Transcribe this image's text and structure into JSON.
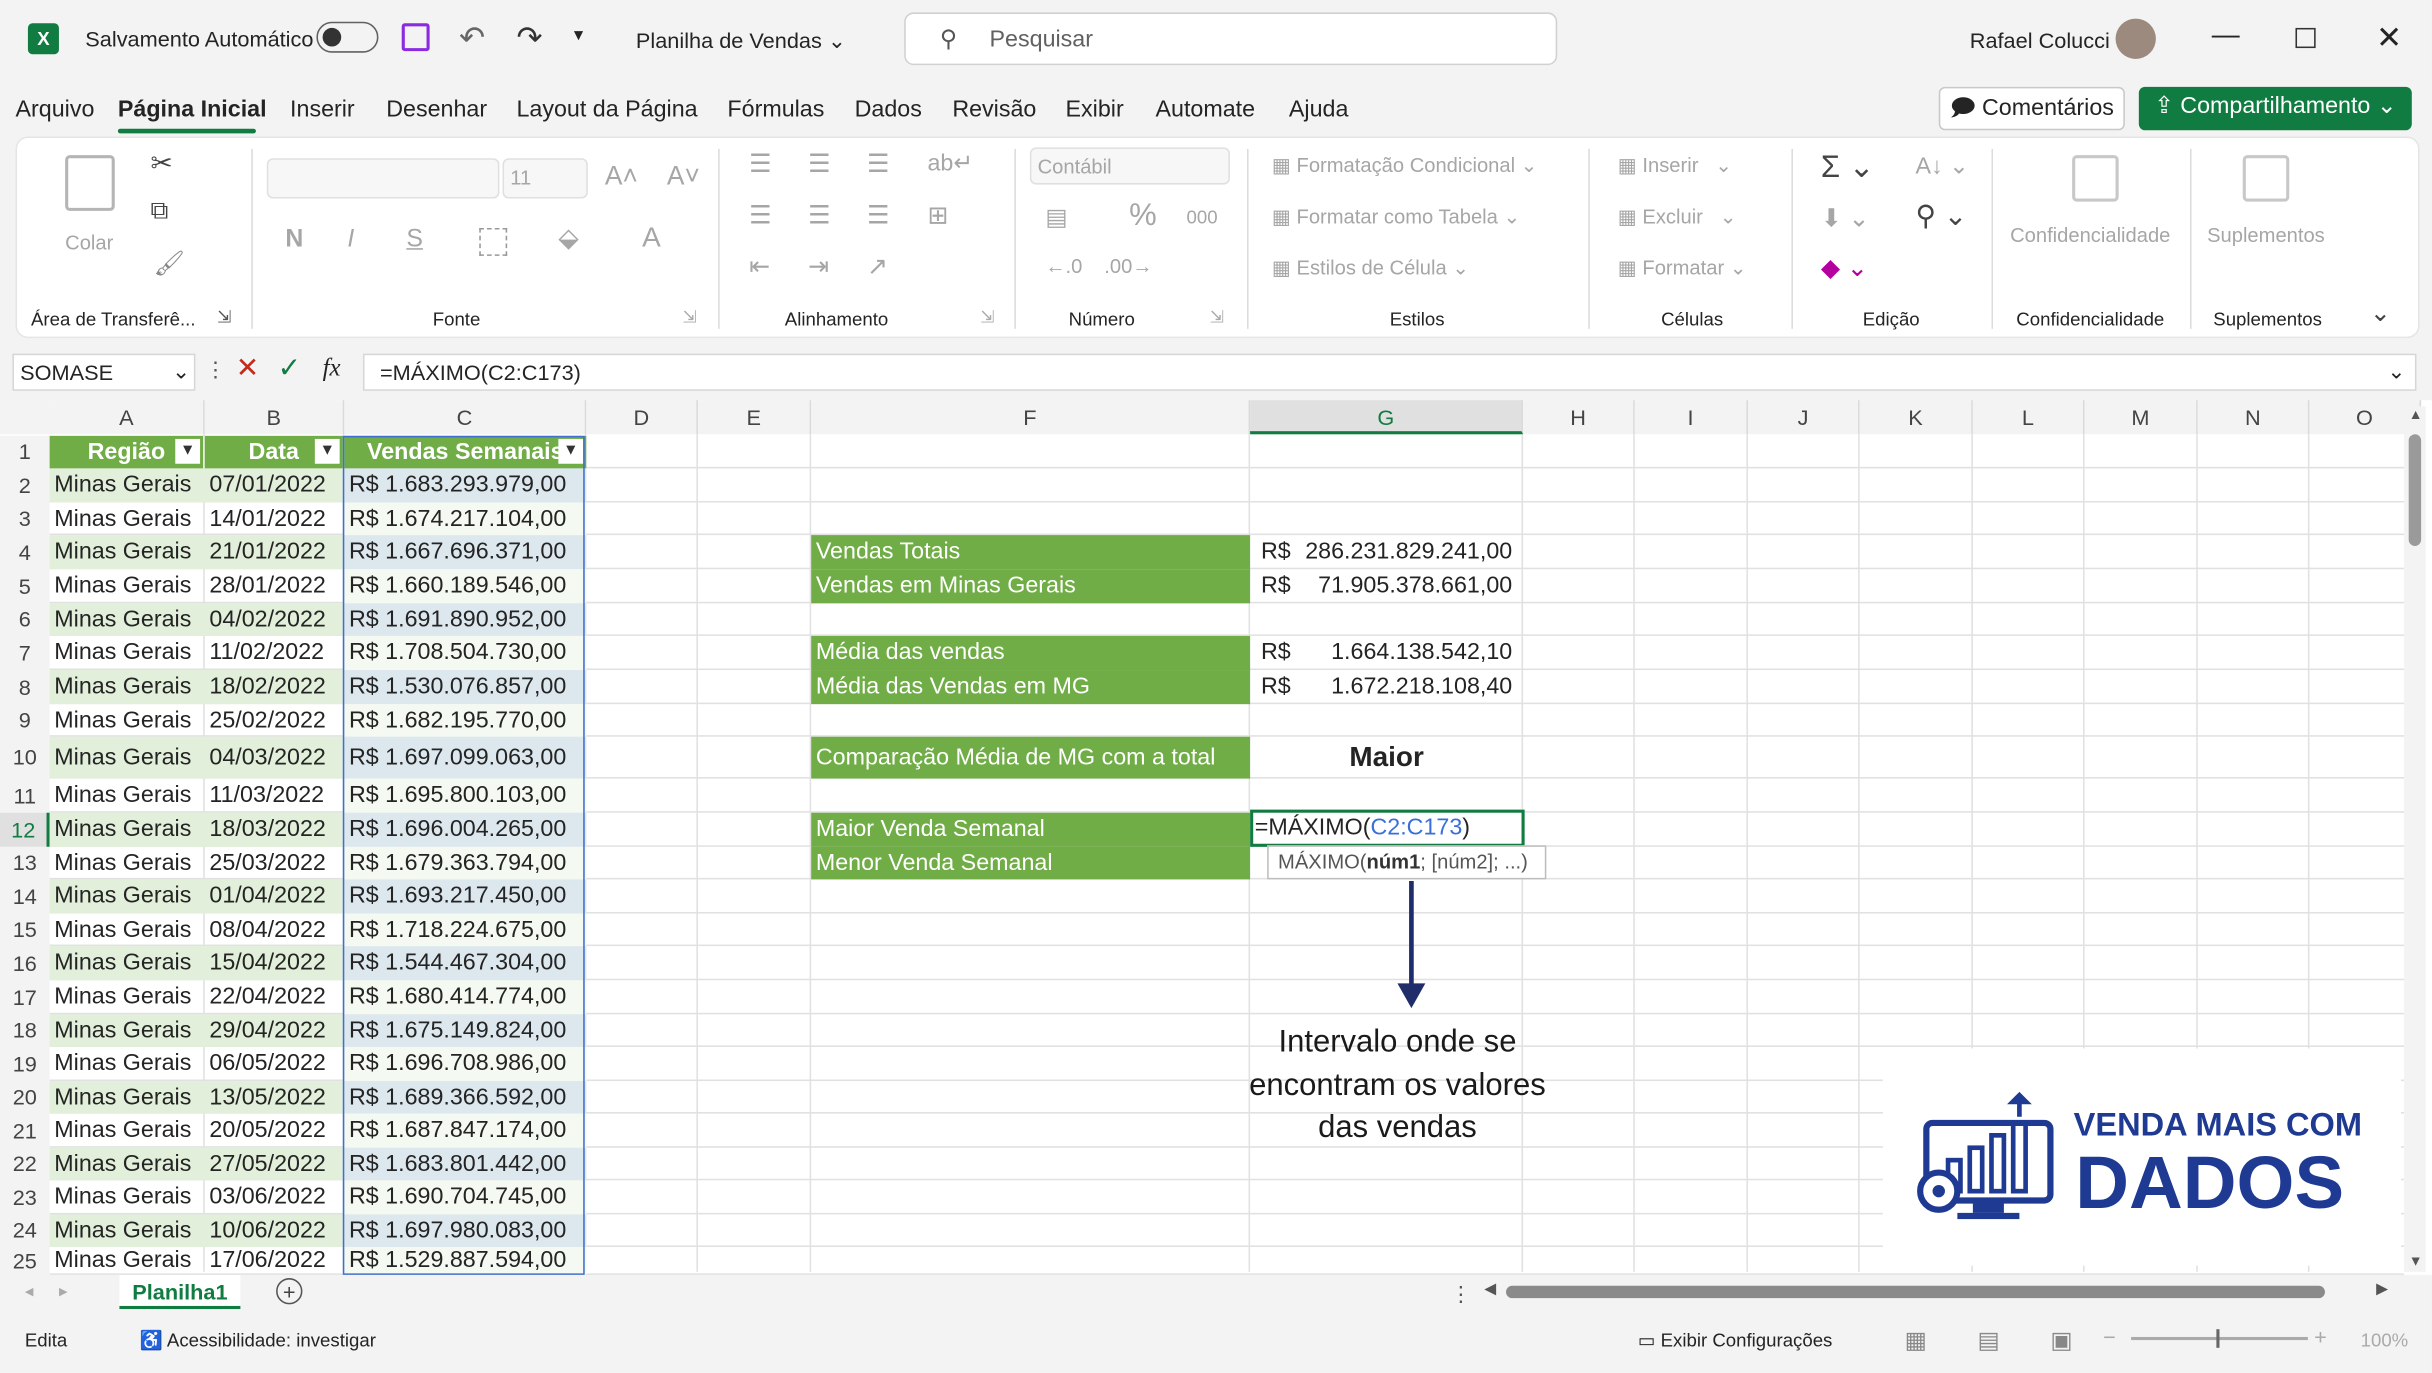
{
  "titlebar": {
    "autosave_label": "Salvamento Automático",
    "filename": "Planilha de Vendas",
    "search_placeholder": "Pesquisar",
    "user_name": "Rafael Colucci"
  },
  "menu": [
    "Arquivo",
    "Página Inicial",
    "Inserir",
    "Desenhar",
    "Layout da Página",
    "Fórmulas",
    "Dados",
    "Revisão",
    "Exibir",
    "Automate",
    "Ajuda"
  ],
  "actions": {
    "comments": "Comentários",
    "share": "Compartilhamento"
  },
  "ribbon": {
    "paste": "Colar",
    "clipboard_group": "Área de Transferê...",
    "font_size": "11",
    "bold": "N",
    "italic": "I",
    "underline": "S",
    "font_group": "Fonte",
    "alignment_group": "Alinhamento",
    "number_format": "Contábil",
    "percent": "%",
    "thousands": "000",
    "number_group": "Número",
    "conditional_formatting": "Formatação Condicional",
    "format_as_table": "Formatar como Tabela",
    "cell_styles": "Estilos de Célula",
    "styles_group": "Estilos",
    "insert": "Inserir",
    "delete": "Excluir",
    "format": "Formatar",
    "cells_group": "Células",
    "editing_group": "Edição",
    "sensitivity": "Confidencialidade",
    "sensitivity_group": "Confidencialidade",
    "addins": "Suplementos",
    "addins_group": "Suplementos"
  },
  "formula_bar": {
    "name_box": "SOMASE",
    "fx": "fx",
    "formula": "=MÁXIMO(C2:C173)"
  },
  "columns": [
    "A",
    "B",
    "C",
    "D",
    "E",
    "F",
    "G",
    "H",
    "I",
    "J",
    "K",
    "L",
    "M",
    "N",
    "O"
  ],
  "table": {
    "headers": [
      "Região",
      "Data",
      "Vendas Semanais"
    ],
    "rows": [
      [
        "Minas Gerais",
        "07/01/2022",
        "R$ 1.683.293.979,00"
      ],
      [
        "Minas Gerais",
        "14/01/2022",
        "R$ 1.674.217.104,00"
      ],
      [
        "Minas Gerais",
        "21/01/2022",
        "R$ 1.667.696.371,00"
      ],
      [
        "Minas Gerais",
        "28/01/2022",
        "R$ 1.660.189.546,00"
      ],
      [
        "Minas Gerais",
        "04/02/2022",
        "R$ 1.691.890.952,00"
      ],
      [
        "Minas Gerais",
        "11/02/2022",
        "R$ 1.708.504.730,00"
      ],
      [
        "Minas Gerais",
        "18/02/2022",
        "R$ 1.530.076.857,00"
      ],
      [
        "Minas Gerais",
        "25/02/2022",
        "R$ 1.682.195.770,00"
      ],
      [
        "Minas Gerais",
        "04/03/2022",
        "R$ 1.697.099.063,00"
      ],
      [
        "Minas Gerais",
        "11/03/2022",
        "R$ 1.695.800.103,00"
      ],
      [
        "Minas Gerais",
        "18/03/2022",
        "R$ 1.696.004.265,00"
      ],
      [
        "Minas Gerais",
        "25/03/2022",
        "R$ 1.679.363.794,00"
      ],
      [
        "Minas Gerais",
        "01/04/2022",
        "R$ 1.693.217.450,00"
      ],
      [
        "Minas Gerais",
        "08/04/2022",
        "R$ 1.718.224.675,00"
      ],
      [
        "Minas Gerais",
        "15/04/2022",
        "R$ 1.544.467.304,00"
      ],
      [
        "Minas Gerais",
        "22/04/2022",
        "R$ 1.680.414.774,00"
      ],
      [
        "Minas Gerais",
        "29/04/2022",
        "R$ 1.675.149.824,00"
      ],
      [
        "Minas Gerais",
        "06/05/2022",
        "R$ 1.696.708.986,00"
      ],
      [
        "Minas Gerais",
        "13/05/2022",
        "R$ 1.689.366.592,00"
      ],
      [
        "Minas Gerais",
        "20/05/2022",
        "R$ 1.687.847.174,00"
      ],
      [
        "Minas Gerais",
        "27/05/2022",
        "R$ 1.683.801.442,00"
      ],
      [
        "Minas Gerais",
        "03/06/2022",
        "R$ 1.690.704.745,00"
      ],
      [
        "Minas Gerais",
        "10/06/2022",
        "R$ 1.697.980.083,00"
      ],
      [
        "Minas Gerais",
        "17/06/2022",
        "R$ 1.529.887.594,00"
      ]
    ]
  },
  "summary": {
    "total_label": "Vendas Totais",
    "total_cur": "R$",
    "total_value": "286.231.829.241,00",
    "mg_label": "Vendas em Minas Gerais",
    "mg_cur": "R$",
    "mg_value": "71.905.378.661,00",
    "avg_label": "Média das vendas",
    "avg_cur": "R$",
    "avg_value": "1.664.138.542,10",
    "avg_mg_label": "Média das Vendas em MG",
    "avg_mg_cur": "R$",
    "avg_mg_value": "1.672.218.108,40",
    "compare_label": "Comparação Média de MG com a total",
    "compare_value": "Maior",
    "max_label": "Maior Venda Semanal",
    "min_label": "Menor Venda Semanal",
    "editing_formula_prefix": "=MÁXIMO(",
    "editing_formula_range": "C2:C173",
    "editing_formula_suffix": ")",
    "tooltip_fn": "MÁXIMO(",
    "tooltip_arg1": "núm1",
    "tooltip_rest": "; [núm2]; ...)"
  },
  "annotation": {
    "line1": "Intervalo onde se",
    "line2": "encontram os valores",
    "line3": "das vendas"
  },
  "logo": {
    "line1": "VENDA MAIS COM",
    "line2": "DADOS"
  },
  "sheet_tab": "Planilha1",
  "statusbar": {
    "mode": "Edita",
    "accessibility": "Acessibilidade: investigar",
    "display_settings": "Exibir Configurações",
    "zoom": "100%"
  },
  "colors": {
    "excel_green": "#107c41",
    "table_green": "#70ad47",
    "light_green": "#e2efda",
    "arrow_navy": "#1f2d6b",
    "logo_blue": "#1f3a93"
  }
}
